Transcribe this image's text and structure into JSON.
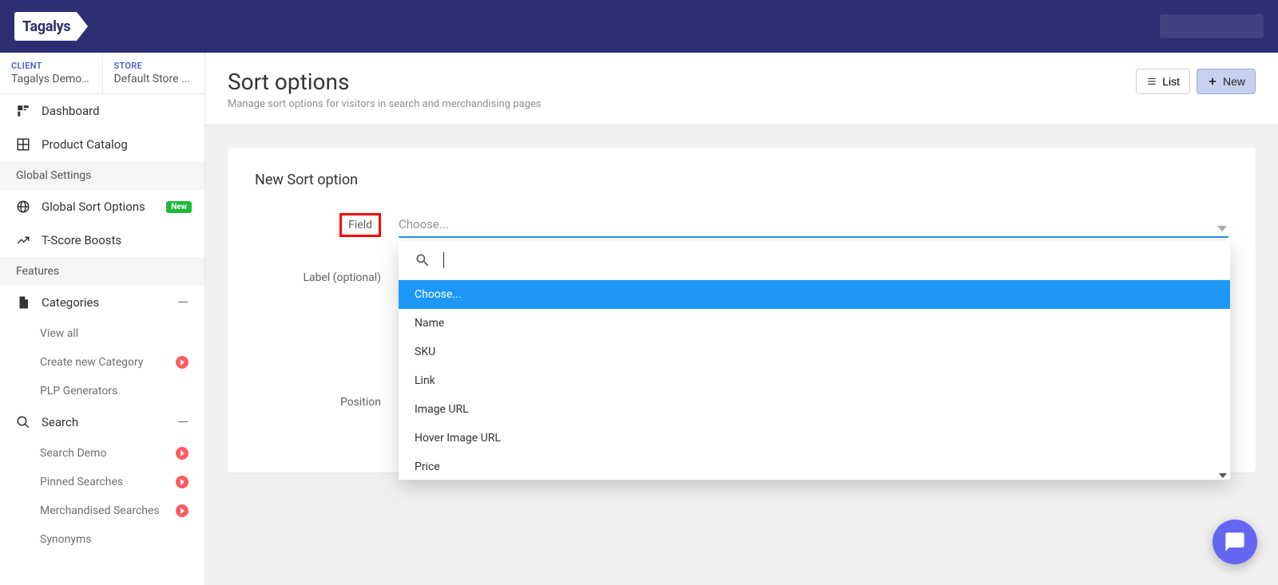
{
  "brand": "Tagalys",
  "client_label": "CLIENT",
  "client_value": "Tagalys Demo ...",
  "store_label": "STORE",
  "store_value": "Default Store ...",
  "nav": {
    "dashboard": "Dashboard",
    "product_catalog": "Product Catalog",
    "global_settings": "Global Settings",
    "global_sort_options": "Global Sort Options",
    "new_badge": "New",
    "tscore_boosts": "T-Score Boosts",
    "features": "Features",
    "categories": "Categories",
    "view_all": "View all",
    "create_new_category": "Create new Category",
    "plp_generators": "PLP Generators",
    "search": "Search",
    "search_demo": "Search Demo",
    "pinned_searches": "Pinned Searches",
    "merchandised_searches": "Merchandised Searches",
    "synonyms": "Synonyms"
  },
  "page": {
    "title": "Sort options",
    "subtitle": "Manage sort options for visitors in search and merchandising pages",
    "btn_list": "List",
    "btn_new": "New"
  },
  "form": {
    "card_title": "New Sort option",
    "field_label": "Field",
    "field_placeholder": "Choose...",
    "label_label": "Label (optional)",
    "position_label": "Position"
  },
  "dropdown": {
    "options": [
      "Choose...",
      "Name",
      "SKU",
      "Link",
      "Image URL",
      "Hover Image URL",
      "Price"
    ]
  }
}
